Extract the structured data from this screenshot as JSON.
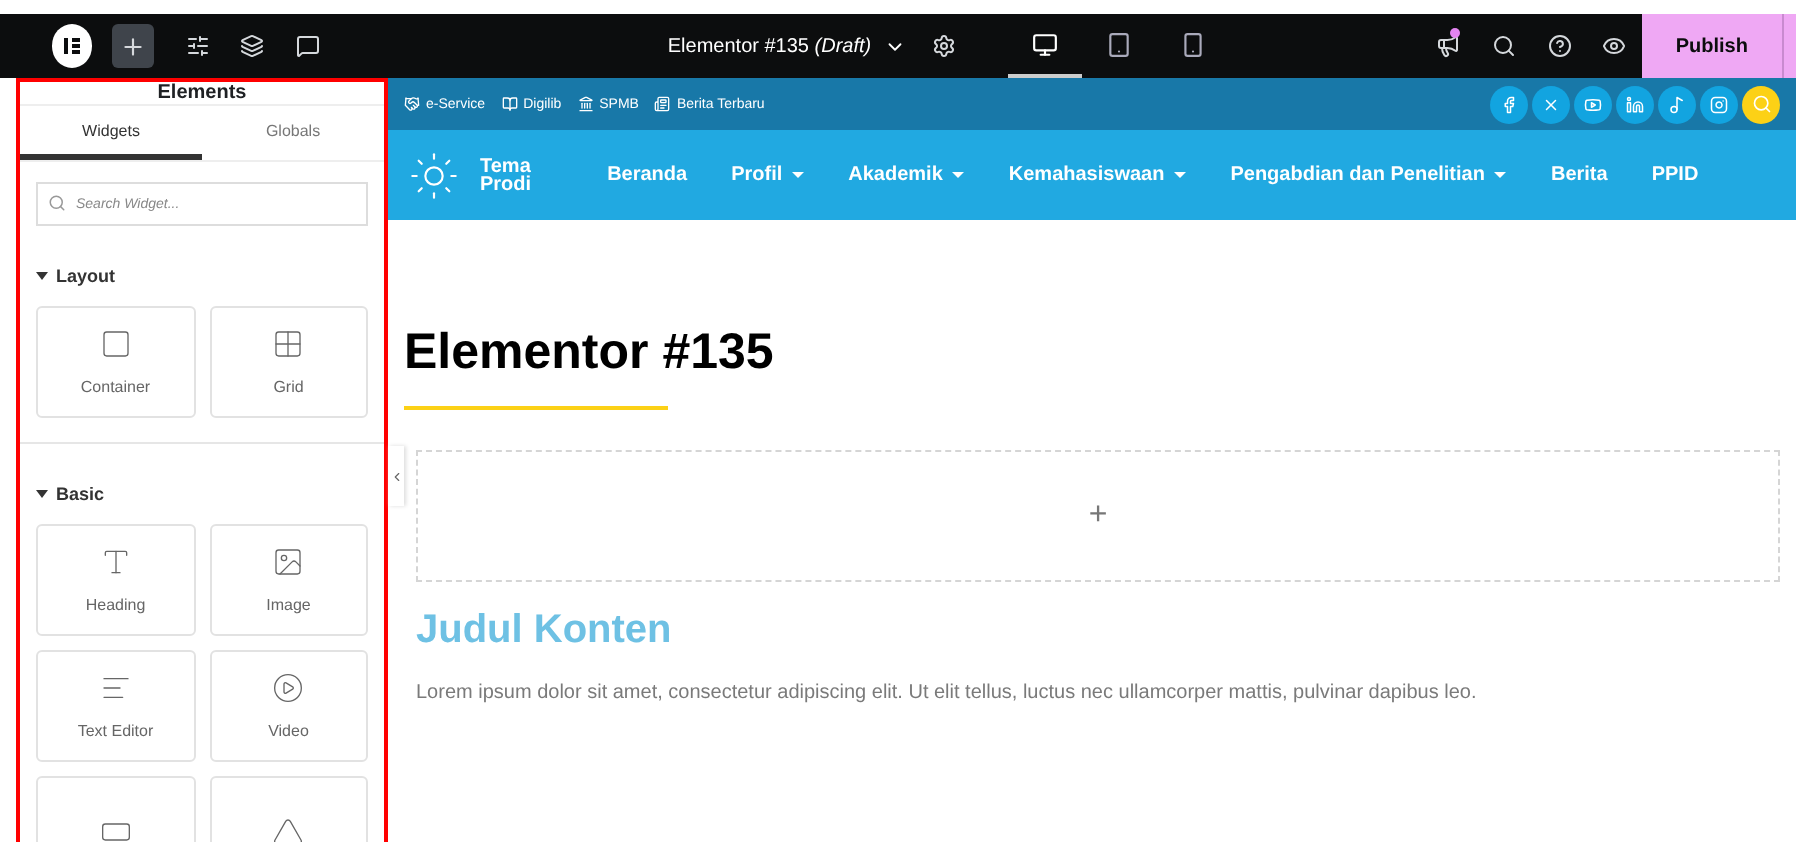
{
  "topbar": {
    "title": "Elementor #135 *(Draft)*",
    "devices": [
      {
        "kind": "desktop",
        "selected": true
      },
      {
        "kind": "tablet",
        "selected": false
      },
      {
        "kind": "mobile",
        "selected": false
      }
    ],
    "notification": true,
    "publish": "Publish"
  },
  "panel": {
    "title": "Elements",
    "tabs": [
      {
        "label": "Widgets",
        "selected": true
      },
      {
        "label": "Globals",
        "selected": false
      }
    ],
    "search": {
      "placeholder": "Search Widget..."
    },
    "categories": [
      {
        "name": "Layout",
        "expanded": true,
        "widgets": [
          {
            "kind": "container",
            "label": "Container"
          },
          {
            "kind": "grid",
            "label": "Grid"
          }
        ]
      },
      {
        "name": "Basic",
        "expanded": true,
        "widgets": [
          {
            "kind": "heading",
            "label": "Heading"
          },
          {
            "kind": "image",
            "label": "Image"
          },
          {
            "kind": "text",
            "label": "Text Editor"
          },
          {
            "kind": "video",
            "label": "Video"
          },
          {
            "kind": "button"
          },
          {
            "kind": "divider"
          }
        ]
      }
    ]
  },
  "site": {
    "top_links": [
      {
        "kind": "handshake",
        "label": "e-Service"
      },
      {
        "kind": "book",
        "label": "Digilib"
      },
      {
        "kind": "bank",
        "label": "SPMB"
      },
      {
        "kind": "news",
        "label": "Berita Terbaru"
      }
    ],
    "socials": [
      {
        "kind": "facebook"
      },
      {
        "kind": "x"
      },
      {
        "kind": "youtube"
      },
      {
        "kind": "linkedin"
      },
      {
        "kind": "tiktok"
      },
      {
        "kind": "instagram"
      }
    ],
    "brand": [
      "Tema",
      "Prodi"
    ],
    "nav": [
      {
        "label": "Beranda",
        "dropdown": false
      },
      {
        "label": "Profil",
        "dropdown": true
      },
      {
        "label": "Akademik",
        "dropdown": true
      },
      {
        "label": "Kemahasiswaan",
        "dropdown": true
      },
      {
        "label": "Pengabdian dan Penelitian",
        "dropdown": true
      },
      {
        "label": "Berita",
        "dropdown": false
      },
      {
        "label": "PPID",
        "dropdown": false
      }
    ]
  },
  "content": {
    "title": "Elementor #135",
    "add_section": "+",
    "heading": "Judul Konten",
    "paragraph": "Lorem ipsum dolor sit amet, consectetur adipiscing elit. Ut elit tellus, luctus nec ullamcorper mattis, pulvinar dapibus leo."
  }
}
